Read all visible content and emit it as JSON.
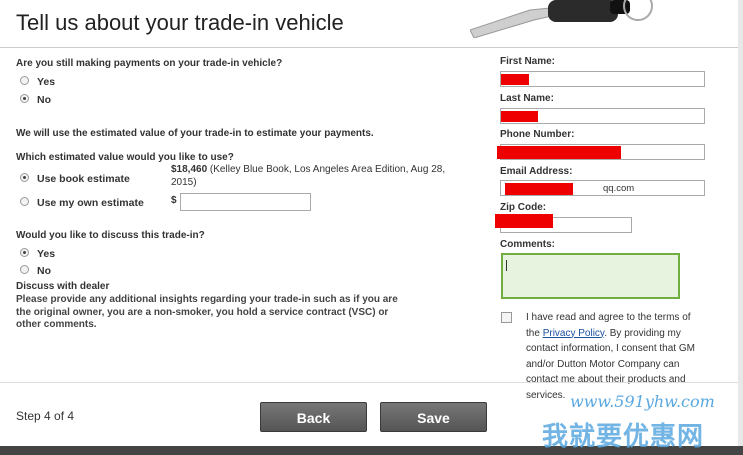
{
  "header": {
    "title": "Tell us about your trade-in vehicle"
  },
  "payments": {
    "question": "Are you still making payments on your trade-in vehicle?",
    "yes": "Yes",
    "no": "No",
    "selected": "No"
  },
  "estimate_note": "We will use the estimated value of your trade-in to estimate your payments.",
  "estimate": {
    "question": "Which estimated value would you like to use?",
    "book_label": "Use book estimate",
    "book_value": "$18,460",
    "book_desc": " (Kelley Blue Book, Los Angeles Area Edition, Aug 28, 2015)",
    "own_label": "Use my own estimate",
    "currency": "$",
    "own_value": "",
    "selected": "Use book estimate"
  },
  "discuss": {
    "question": "Would you like to discuss this trade-in?",
    "yes": "Yes",
    "no": "No",
    "selected": "Yes",
    "dealer_heading": "Discuss with dealer",
    "dealer_text": "Please provide any additional insights regarding your trade-in such as if you are the original owner, you are a non-smoker, you hold a service contract (VSC) or other comments."
  },
  "contact": {
    "first_name_label": "First Name:",
    "last_name_label": "Last Name:",
    "phone_label": "Phone Number:",
    "email_label": "Email Address:",
    "email_visible": "qq.com",
    "zip_label": "Zip Code:",
    "comments_label": "Comments:",
    "terms_pre": "I have read and agree to the terms of the ",
    "terms_link": "Privacy Policy",
    "terms_post": ". By providing my contact information, I consent that GM and/or Dutton Motor Company can contact me about their products and services."
  },
  "footer": {
    "step": "Step 4 of 4",
    "back": "Back",
    "save": "Save"
  },
  "watermark": {
    "url": "www.591yhw.com",
    "text": "我就要优惠网"
  },
  "colors": {
    "redaction": "#e00000",
    "comments_border": "#6fae3f",
    "button": "#5a5a5a",
    "link": "#1c4fa0"
  }
}
